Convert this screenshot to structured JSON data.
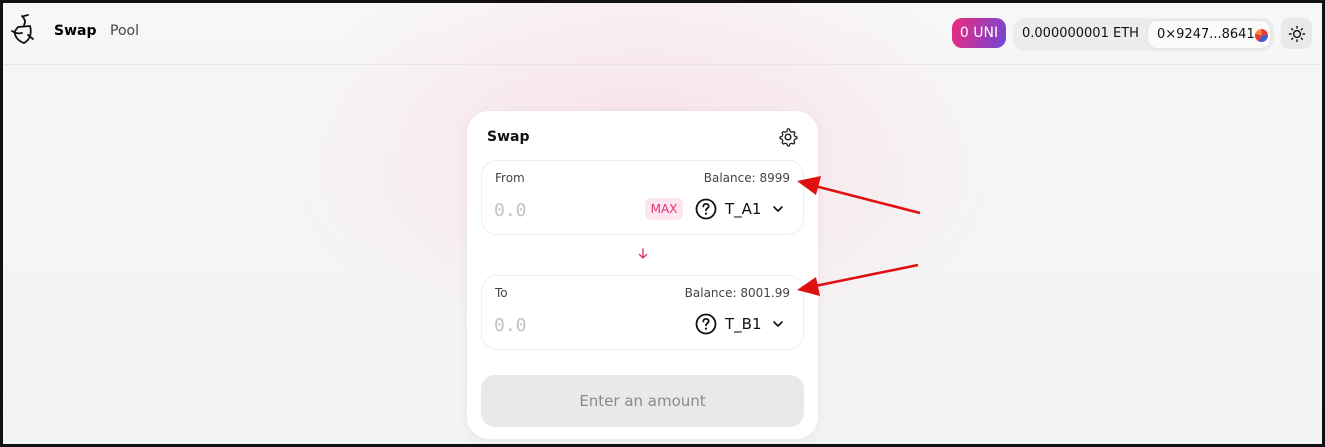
{
  "header": {
    "nav": {
      "swap": "Swap",
      "pool": "Pool"
    },
    "uni_badge": "0 UNI",
    "eth_balance": "0.000000001 ETH",
    "address": "0×9247...8641"
  },
  "swap_card": {
    "title": "Swap",
    "from": {
      "label": "From",
      "balance": "Balance: 8999",
      "placeholder": "0.0",
      "max_label": "MAX",
      "token": "T_A1"
    },
    "to": {
      "label": "To",
      "balance": "Balance: 8001.99",
      "placeholder": "0.0",
      "token": "T_B1"
    },
    "submit_label": "Enter an amount"
  },
  "colors": {
    "accent": "#e5307a",
    "annotation_arrow": "#e01010"
  },
  "icons": [
    "logo-icon",
    "identicon",
    "sun-icon",
    "gear-icon",
    "question-circle-icon",
    "chevron-down-icon",
    "arrow-down-icon"
  ]
}
